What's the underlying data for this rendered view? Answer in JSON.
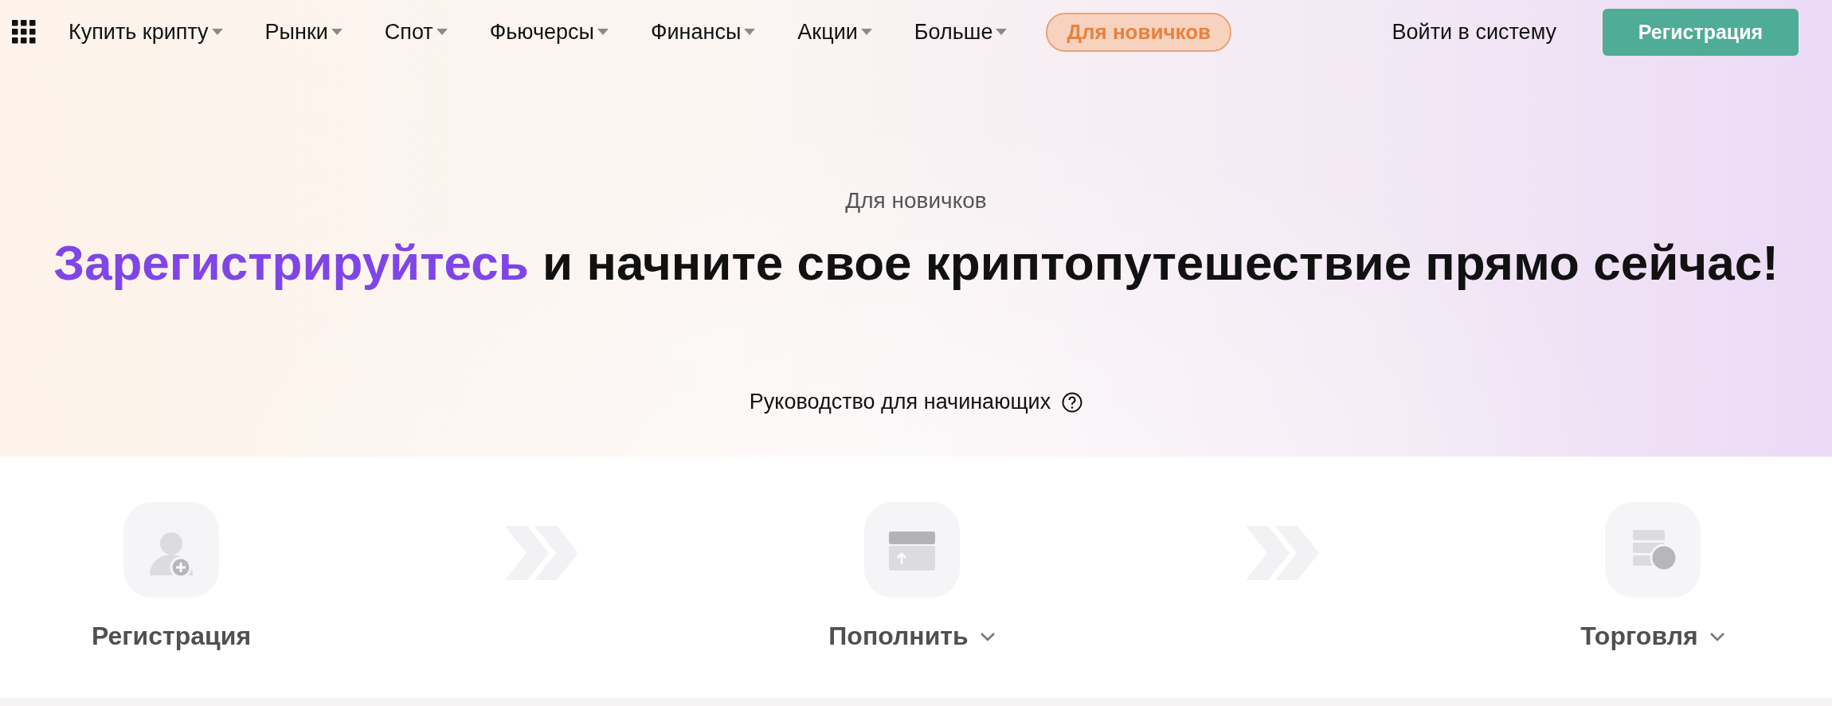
{
  "nav": {
    "items": [
      {
        "label": "Купить крипту",
        "dropdown": true
      },
      {
        "label": "Рынки",
        "dropdown": true
      },
      {
        "label": "Спот",
        "dropdown": true
      },
      {
        "label": "Фьючерсы",
        "dropdown": true
      },
      {
        "label": "Финансы",
        "dropdown": true
      },
      {
        "label": "Акции",
        "dropdown": true
      },
      {
        "label": "Больше",
        "dropdown": true
      }
    ],
    "badge": "Для новичков",
    "login": "Войти в систему",
    "register": "Регистрация"
  },
  "hero": {
    "eyebrow": "Для новичков",
    "headline_highlight": "Зарегистрируйтесь",
    "headline_rest": "и начните свое криптопутешествие прямо сейчас!",
    "guide_link": "Руководство для начинающих"
  },
  "steps": [
    {
      "kind": "user-add",
      "label": "Регистрация",
      "dropdown": false
    },
    {
      "kind": "deposit",
      "label": "Пополнить",
      "dropdown": true
    },
    {
      "kind": "trade",
      "label": "Торговля",
      "dropdown": true
    }
  ]
}
